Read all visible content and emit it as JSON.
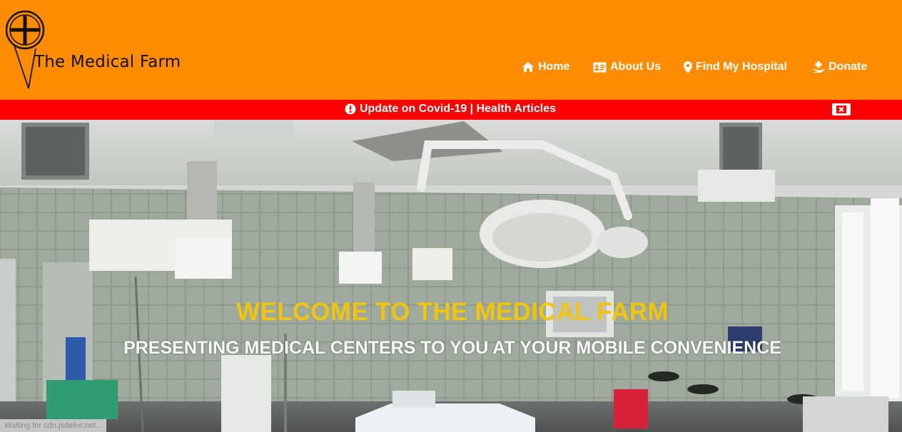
{
  "brand": {
    "name": "The Medical Farm"
  },
  "nav": {
    "home": "Home",
    "about": "About Us",
    "find": "Find My Hospital",
    "donate": "Donate"
  },
  "alert": {
    "text": "Update on Covid-19 | Health Articles"
  },
  "hero": {
    "title": "WELCOME TO THE MEDICAL FARM",
    "subtitle": "PRESENTING MEDICAL CENTERS TO YOU AT YOUR MOBILE CONVENIENCE"
  },
  "status_bar": {
    "text": "Waiting for cdn.jsdelivr.net..."
  },
  "colors": {
    "header_bg": "#ff8c00",
    "alert_bg": "#ff0000",
    "hero_title": "#f1c40f",
    "nav_text": "#ffffff"
  },
  "icons": {
    "home": "home-icon",
    "about": "id-card-icon",
    "find": "map-marker-icon",
    "donate": "hand-holding-medical-icon",
    "alert": "exclamation-circle-icon",
    "close": "close-window-icon",
    "logo": "medical-cross-pin-logo"
  }
}
